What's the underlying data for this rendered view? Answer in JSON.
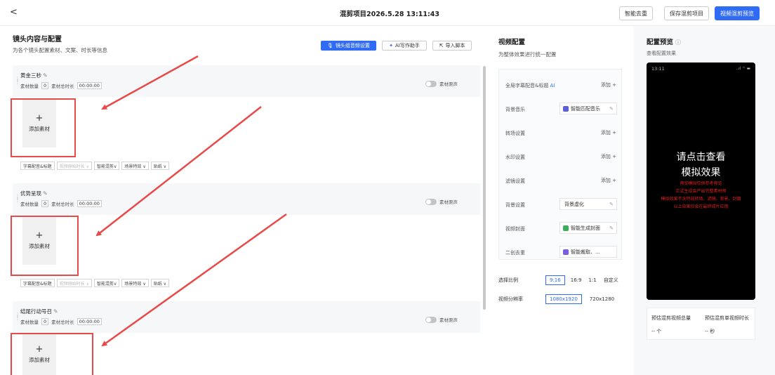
{
  "header": {
    "back_label": "<",
    "title": "混剪项目2026.5.28 13:11:43",
    "buttons": {
      "dedup": "智能去重",
      "save": "保存混剪项目",
      "preview": "视频混剪预览"
    }
  },
  "left": {
    "title": "镜头内容与配置",
    "subtitle": "为各个镜头配置素材、文案、时长等信息",
    "toolbar": {
      "audio_settings": "镜头组音频设置",
      "ai_writer": "AI写作助手",
      "import_script": "导入脚本"
    },
    "sections": [
      {
        "name": "黄金三秒",
        "count_label": "素材数量",
        "count": "0",
        "duration_label": "素材总时长",
        "duration": "00:00:00",
        "toggle_label": "素材原声",
        "add_label": "添加素材",
        "add_plus": "+",
        "options": [
          "字幕配音&标题",
          "视频原始时长 ∨",
          "智能混剪∨",
          "场景特效 ∨",
          "贴纸 ∨"
        ]
      },
      {
        "name": "优势呈现",
        "count_label": "素材数量",
        "count": "0",
        "duration_label": "素材总时长",
        "duration": "00:00:00",
        "toggle_label": "素材原声",
        "add_label": "添加素材",
        "add_plus": "+",
        "options": [
          "字幕配音&标题",
          "视频原始时长 ∨",
          "智能混剪∨",
          "场景特效 ∨",
          "贴纸 ∨"
        ]
      },
      {
        "name": "结尾行动号召",
        "count_label": "素材数量",
        "count": "0",
        "duration_label": "素材总时长",
        "duration": "00:00:00",
        "toggle_label": "素材原声",
        "add_label": "添加素材",
        "add_plus": "+"
      }
    ]
  },
  "middle": {
    "title": "视频配置",
    "subtitle": "为整体效果进行统一配置",
    "add_label": "添加 +",
    "rows": [
      {
        "label": "全局字幕配音&标题",
        "ai": "AI"
      },
      {
        "label": "背景音乐",
        "value": "智能匹配音乐"
      },
      {
        "label": "转场设置"
      },
      {
        "label": "水印设置"
      },
      {
        "label": "滤镜设置"
      },
      {
        "label": "背景设置",
        "value": "背景虚化"
      },
      {
        "label": "视频封面",
        "value": "智能生成封面"
      },
      {
        "label": "二创去重",
        "value": "智能裁取、..."
      }
    ],
    "ratio": {
      "label": "选择比例",
      "options": [
        "9:16",
        "16:9",
        "1:1",
        "自定义"
      ]
    },
    "resolution": {
      "label": "视频分辨率",
      "options": [
        "1080x1920",
        "720x1280"
      ]
    }
  },
  "right": {
    "title": "配置预览",
    "subtitle": "查看配置效果",
    "phone": {
      "time": "13:11",
      "status": "..ıl ⌔ ▬",
      "big_line1": "请点击查看",
      "big_line2": "模拟效果",
      "red_lines": [
        "预览模拟仅供参考预览",
        "正式生成会产出完整素材预",
        "模拟效果不含特效转场、滤镜、背景、封面",
        "以上效果仅会在最终成片应用"
      ]
    },
    "stats": {
      "total_label": "预估混剪视频总量",
      "total_value": "-- 个",
      "single_label": "预估混剪单视频时长",
      "single_value": "-- 秒"
    }
  },
  "colors": {
    "accent": "#2f6bf5",
    "highlight": "#e84a4a"
  }
}
